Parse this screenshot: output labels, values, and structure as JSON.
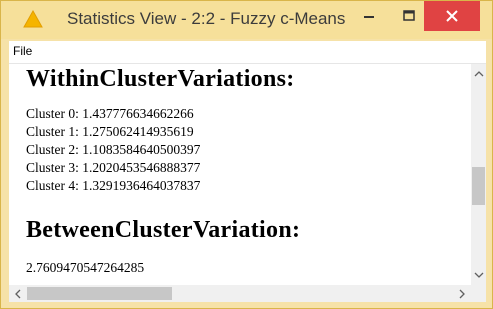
{
  "window": {
    "title": "Statistics View - 2:2 - Fuzzy c-Means",
    "icon": "warning-triangle-icon",
    "controls": [
      "minimize-icon",
      "maximize-icon",
      "close-icon"
    ],
    "colors": {
      "titlebar": "#f6e09a",
      "close": "#e04343"
    }
  },
  "menu": {
    "file": "File"
  },
  "content": {
    "within_heading": "WithinClusterVariations:",
    "clusters": [
      "Cluster 0: 1.437776634662266",
      "Cluster 1: 1.275062414935619",
      "Cluster 2: 1.1083584640500397",
      "Cluster 3: 1.2020453546888377",
      "Cluster 4: 1.3291936464037837"
    ],
    "between_heading": "BetweenClusterVariation:",
    "between_value": "2.7609470547264285"
  },
  "scrollbars": {
    "vertical": {
      "up": "‹",
      "down": "›"
    },
    "horizontal": {
      "left": "<",
      "right": ">"
    }
  }
}
